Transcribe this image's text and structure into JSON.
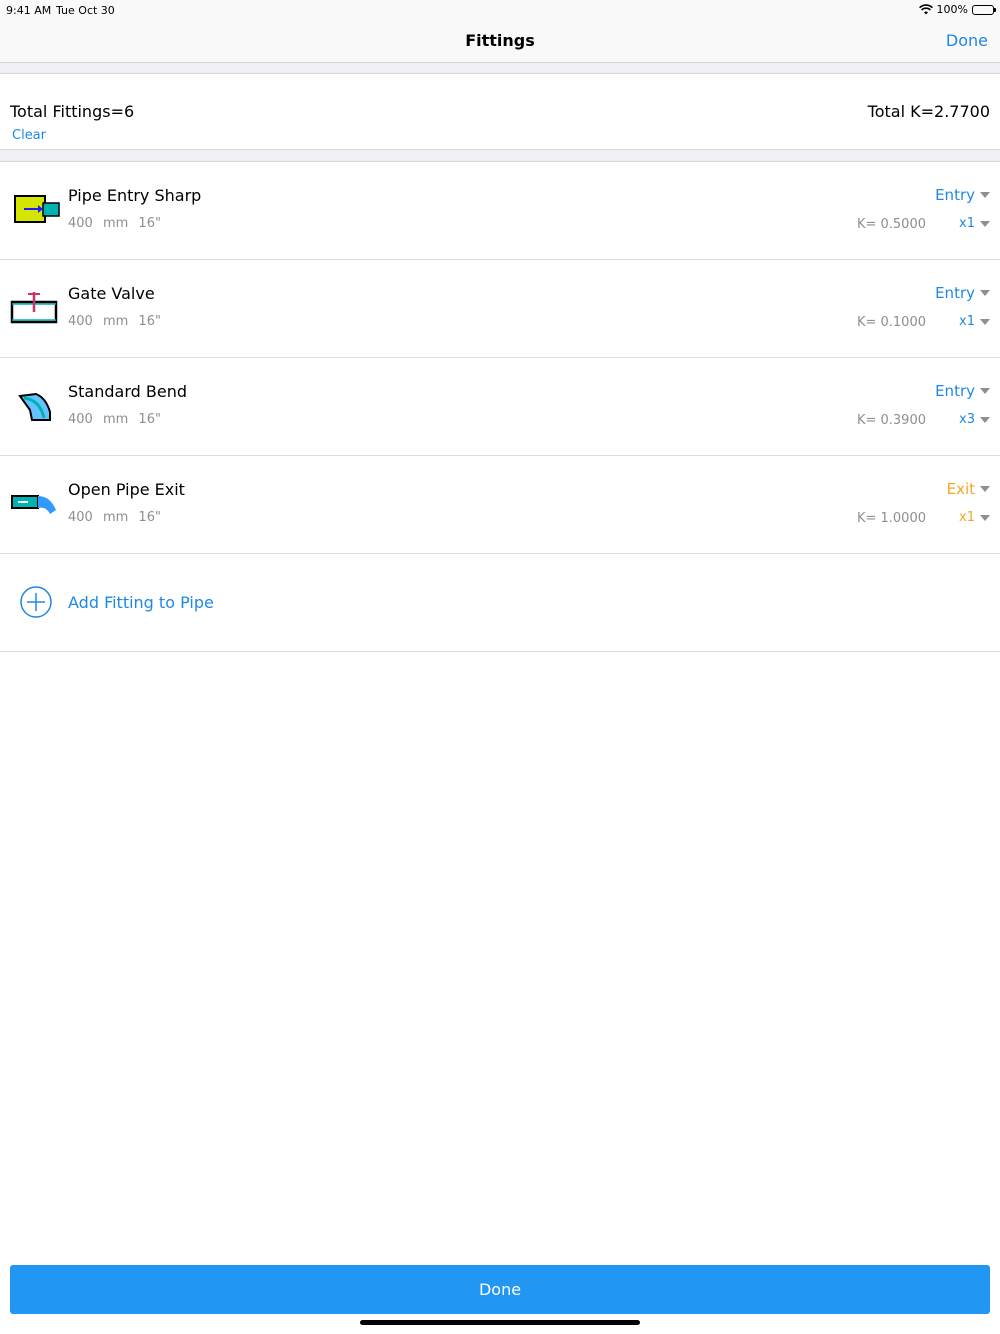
{
  "status": {
    "time": "9:41 AM",
    "date": "Tue Oct 30",
    "battery": "100%"
  },
  "nav": {
    "title": "Fittings",
    "done_label": "Done"
  },
  "summary": {
    "total_fittings": "Total Fittings=6",
    "total_k": "Total K=2.7700",
    "clear_label": "Clear"
  },
  "fittings": [
    {
      "name": "Pipe Entry Sharp",
      "size_mm": "400 mm",
      "size_in": "16\"",
      "type": "Entry",
      "k": "K= 0.5000",
      "mult": "x1",
      "icon": "pipe-entry-sharp-icon"
    },
    {
      "name": "Gate Valve",
      "size_mm": "400 mm",
      "size_in": "16\"",
      "type": "Entry",
      "k": "K= 0.1000",
      "mult": "x1",
      "icon": "gate-valve-icon"
    },
    {
      "name": "Standard Bend",
      "size_mm": "400 mm",
      "size_in": "16\"",
      "type": "Entry",
      "k": "K= 0.3900",
      "mult": "x3",
      "icon": "standard-bend-icon"
    },
    {
      "name": "Open Pipe Exit",
      "size_mm": "400 mm",
      "size_in": "16\"",
      "type": "Exit",
      "k": "K= 1.0000",
      "mult": "x1",
      "icon": "open-pipe-exit-icon"
    }
  ],
  "add_label": "Add Fitting to Pipe",
  "bottom_done_label": "Done",
  "colors": {
    "accent": "#1e88e5",
    "exit": "#f5a623",
    "button": "#2196f3"
  }
}
